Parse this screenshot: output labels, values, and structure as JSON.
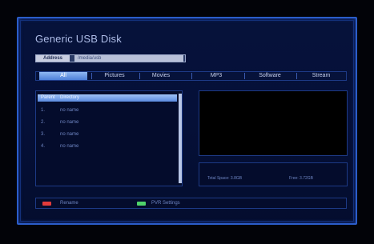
{
  "title": "Generic USB Disk",
  "path": {
    "label": "Address",
    "value": "/media/usb"
  },
  "tabs": [
    {
      "label": "All",
      "active": true
    },
    {
      "label": "Pictures",
      "active": false
    },
    {
      "label": "Movies",
      "active": false
    },
    {
      "label": "MP3",
      "active": false
    },
    {
      "label": "Software",
      "active": false
    },
    {
      "label": "Stream",
      "active": false
    }
  ],
  "files": [
    {
      "num": "Parent",
      "name": "Directory",
      "selected": true
    },
    {
      "num": "1.",
      "name": "no name",
      "selected": false
    },
    {
      "num": "2.",
      "name": "no name",
      "selected": false
    },
    {
      "num": "3.",
      "name": "no name",
      "selected": false
    },
    {
      "num": "4.",
      "name": "no name",
      "selected": false
    }
  ],
  "info": {
    "total_space": "Total Space: 3.8GB",
    "free_space": "Free: 3.72GB"
  },
  "footer": {
    "red_label": "Rename",
    "green_label": "PVR Settings"
  },
  "colors": {
    "frame_border": "#2b5dc9",
    "background": "#06123a",
    "selection": "#5a8be0",
    "key_red": "#e33b3b",
    "key_green": "#4fd36a"
  }
}
